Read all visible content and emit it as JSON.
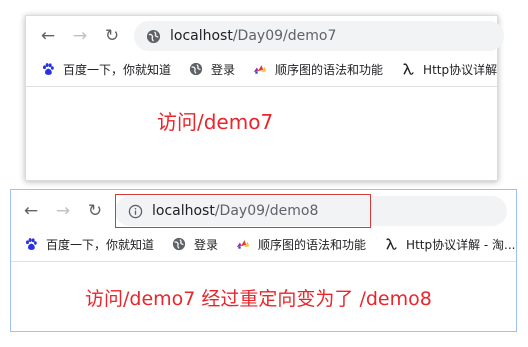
{
  "window1": {
    "url_host": "localhost",
    "url_path": "/Day09/demo7",
    "page_text": "访问/demo7"
  },
  "window2": {
    "url_host": "localhost",
    "url_path": "/Day09/demo8",
    "page_text": "访问/demo7 经过重定向变为了 /demo8"
  },
  "bookmarks1": [
    {
      "label": "百度一下，你就知道",
      "icon": "baidu-paw-icon"
    },
    {
      "label": "登录",
      "icon": "globe-icon"
    },
    {
      "label": "顺序图的语法和功能",
      "icon": "plantuml-icon"
    },
    {
      "label": "Http协议详解",
      "icon": "lambda-icon"
    }
  ],
  "bookmarks2": [
    {
      "label": "百度一下，你就知道",
      "icon": "baidu-paw-icon"
    },
    {
      "label": "登录",
      "icon": "globe-icon"
    },
    {
      "label": "顺序图的语法和功能",
      "icon": "plantuml-icon"
    },
    {
      "label": "Http协议详解 - 淘...",
      "icon": "lambda-icon"
    }
  ],
  "colors": {
    "page_text": "#e8262c",
    "highlight_box": "#d33b3b",
    "window2_border": "#9ec3ef",
    "omnibox_bg": "#f1f3f4"
  }
}
